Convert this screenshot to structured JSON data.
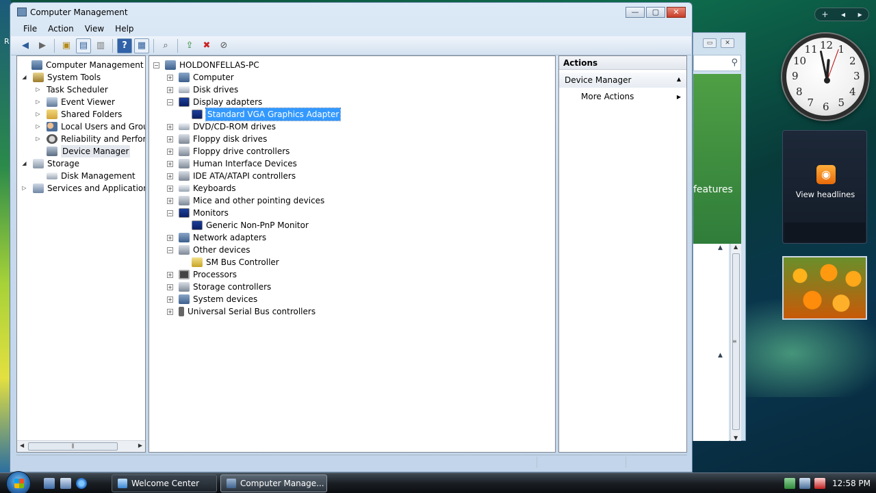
{
  "window": {
    "title": "Computer Management",
    "caption": {
      "minimize": "—",
      "maximize": "▢",
      "close": "✕"
    }
  },
  "menu": [
    "File",
    "Action",
    "View",
    "Help"
  ],
  "left_tree": [
    {
      "label": "Computer Management (Local",
      "icon": "computer-management-icon"
    },
    {
      "label": "System Tools",
      "icon": "system-tools-icon"
    },
    {
      "label": "Task Scheduler",
      "icon": "task-scheduler-icon"
    },
    {
      "label": "Event Viewer",
      "icon": "event-viewer-icon"
    },
    {
      "label": "Shared Folders",
      "icon": "shared-folders-icon"
    },
    {
      "label": "Local Users and Groups",
      "icon": "users-icon"
    },
    {
      "label": "Reliability and Performa",
      "icon": "gauge-icon"
    },
    {
      "label": "Device Manager",
      "icon": "device-manager-icon"
    },
    {
      "label": "Storage",
      "icon": "storage-icon"
    },
    {
      "label": "Disk Management",
      "icon": "disk-icon"
    },
    {
      "label": "Services and Applications",
      "icon": "services-icon"
    }
  ],
  "device_tree": [
    {
      "label": "HOLDONFELLAS-PC",
      "icon": "computer-icon"
    },
    {
      "label": "Computer",
      "icon": "computer-icon"
    },
    {
      "label": "Disk drives",
      "icon": "disk-drive-icon"
    },
    {
      "label": "Display adapters",
      "icon": "display-icon"
    },
    {
      "label": "Standard VGA Graphics Adapter",
      "icon": "display-icon"
    },
    {
      "label": "DVD/CD-ROM drives",
      "icon": "dvd-icon"
    },
    {
      "label": "Floppy disk drives",
      "icon": "floppy-icon"
    },
    {
      "label": "Floppy drive controllers",
      "icon": "floppy-controller-icon"
    },
    {
      "label": "Human Interface Devices",
      "icon": "hid-icon"
    },
    {
      "label": "IDE ATA/ATAPI controllers",
      "icon": "ide-icon"
    },
    {
      "label": "Keyboards",
      "icon": "keyboard-icon"
    },
    {
      "label": "Mice and other pointing devices",
      "icon": "mouse-icon"
    },
    {
      "label": "Monitors",
      "icon": "monitor-icon"
    },
    {
      "label": "Generic Non-PnP Monitor",
      "icon": "monitor-icon"
    },
    {
      "label": "Network adapters",
      "icon": "network-icon"
    },
    {
      "label": "Other devices",
      "icon": "other-devices-icon"
    },
    {
      "label": "SM Bus Controller",
      "icon": "warning-device-icon"
    },
    {
      "label": "Processors",
      "icon": "processor-icon"
    },
    {
      "label": "Storage controllers",
      "icon": "storage-controller-icon"
    },
    {
      "label": "System devices",
      "icon": "system-devices-icon"
    },
    {
      "label": "Universal Serial Bus controllers",
      "icon": "usb-icon"
    }
  ],
  "actions": {
    "header": "Actions",
    "section": "Device Manager",
    "item": "More Actions"
  },
  "background_window": {
    "text": "features"
  },
  "gadgets": {
    "feed_label": "View headlines",
    "clock_numbers": [
      "12",
      "1",
      "2",
      "3",
      "4",
      "5",
      "6",
      "7",
      "8",
      "9",
      "10",
      "11"
    ]
  },
  "taskbar": {
    "buttons": [
      {
        "label": "Welcome Center",
        "active": false
      },
      {
        "label": "Computer Manage...",
        "active": true
      }
    ],
    "clock": "12:58 PM"
  },
  "desktop": {
    "edge_text": "R"
  },
  "colors": {
    "selection": "#3399ff",
    "accent": "#2b5d9a"
  }
}
